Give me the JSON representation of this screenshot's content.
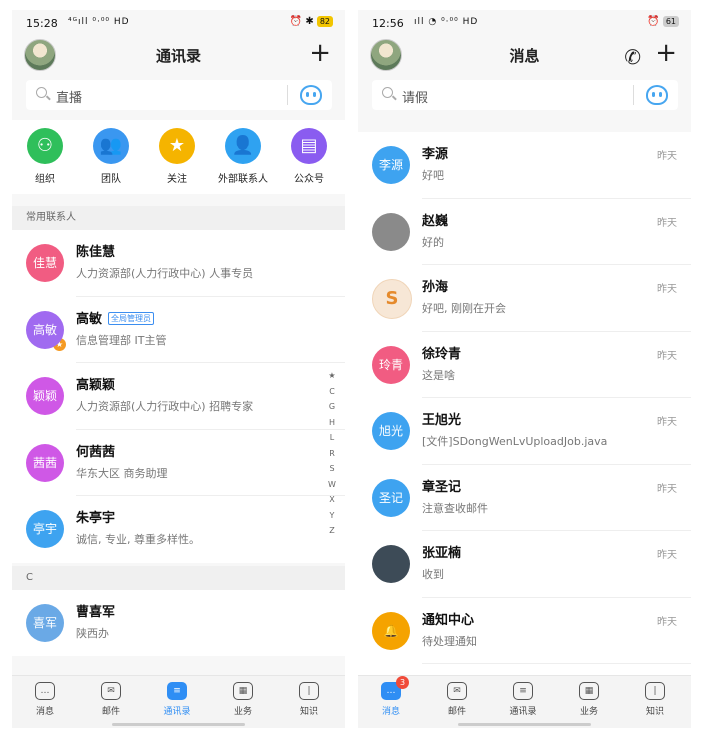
{
  "contacts_screen": {
    "status": {
      "time": "15:28",
      "signal": "⁴ᴳıll ⁰·⁰⁰ HD",
      "battery": "82",
      "battery_color": "#f2c500"
    },
    "title": "通讯录",
    "search_placeholder": "直播",
    "quick_actions": [
      {
        "label": "组织",
        "color": "#2fbf5b",
        "glyph": "⚇"
      },
      {
        "label": "团队",
        "color": "#3a97f0",
        "glyph": "👥"
      },
      {
        "label": "关注",
        "color": "#f5b400",
        "glyph": "★"
      },
      {
        "label": "外部联系人",
        "color": "#2fa2f1",
        "glyph": "👤"
      },
      {
        "label": "公众号",
        "color": "#8a5cf0",
        "glyph": "▤"
      }
    ],
    "section_frequent": "常用联系人",
    "frequent": [
      {
        "avatar": "佳慧",
        "color": "#f15c82",
        "name": "陈佳慧",
        "sub": "人力资源部(人力行政中心) 人事专员"
      },
      {
        "avatar": "高敏",
        "color": "#a06af0",
        "name": "高敏",
        "badge": "全局管理员",
        "sub": "信息管理部 IT主管"
      },
      {
        "avatar": "颖颖",
        "color": "#cf58e6",
        "name": "高颖颖",
        "sub": "人力资源部(人力行政中心) 招聘专家"
      },
      {
        "avatar": "茜茜",
        "color": "#cf58e6",
        "name": "何茜茜",
        "sub": "华东大区 商务助理"
      },
      {
        "avatar": "亭宇",
        "color": "#3ea3f0",
        "name": "朱亭宇",
        "sub": "诚信, 专业, 尊重多样性。"
      }
    ],
    "section_c": "C",
    "c_list": [
      {
        "avatar": "喜军",
        "color": "#6aa9e6",
        "name": "曹喜军",
        "sub": "陕西办"
      }
    ],
    "alpha_index": [
      "★",
      "C",
      "G",
      "H",
      "L",
      "R",
      "S",
      "W",
      "X",
      "Y",
      "Z"
    ],
    "tabs": [
      {
        "label": "消息",
        "glyph": "…"
      },
      {
        "label": "邮件",
        "glyph": "✉"
      },
      {
        "label": "通讯录",
        "glyph": "≡"
      },
      {
        "label": "业务",
        "glyph": "▦"
      },
      {
        "label": "知识",
        "glyph": "|"
      }
    ],
    "active_tab": 2
  },
  "messages_screen": {
    "status": {
      "time": "12:56",
      "signal": "ıll ◔ ⁰·⁰⁰ HD",
      "battery": "61",
      "battery_color": "#cccccc"
    },
    "title": "消息",
    "search_placeholder": "请假",
    "messages": [
      {
        "avatar": "李源",
        "color": "#3ea3f0",
        "name": "李源",
        "preview": "好吧",
        "time": "昨天"
      },
      {
        "avatar": "",
        "color": "#8a8a8a",
        "name": "赵巍",
        "preview": "好的",
        "time": "昨天"
      },
      {
        "avatar": "S",
        "color": "#f7e7d6",
        "name": "孙海",
        "preview": "好吧, 刚刚在开会",
        "time": "昨天"
      },
      {
        "avatar": "玲青",
        "color": "#f15c82",
        "name": "徐玲青",
        "preview": "这是啥",
        "time": "昨天"
      },
      {
        "avatar": "旭光",
        "color": "#3ea3f0",
        "name": "王旭光",
        "preview": "[文件]SDongWenLvUploadJob.java",
        "time": "昨天"
      },
      {
        "avatar": "圣记",
        "color": "#3ea3f0",
        "name": "章圣记",
        "preview": "注意查收邮件",
        "time": "昨天"
      },
      {
        "avatar": "",
        "color": "#3d4b57",
        "name": "张亚楠",
        "preview": "收到",
        "time": "昨天"
      },
      {
        "avatar": "🔔",
        "color": "#f5a300",
        "name": "通知中心",
        "preview": "待处理通知",
        "time": "昨天"
      }
    ],
    "tabs": [
      {
        "label": "消息",
        "glyph": "…",
        "badge": "3"
      },
      {
        "label": "邮件",
        "glyph": "✉"
      },
      {
        "label": "通讯录",
        "glyph": "≡"
      },
      {
        "label": "业务",
        "glyph": "▦"
      },
      {
        "label": "知识",
        "glyph": "|"
      }
    ],
    "active_tab": 0
  }
}
